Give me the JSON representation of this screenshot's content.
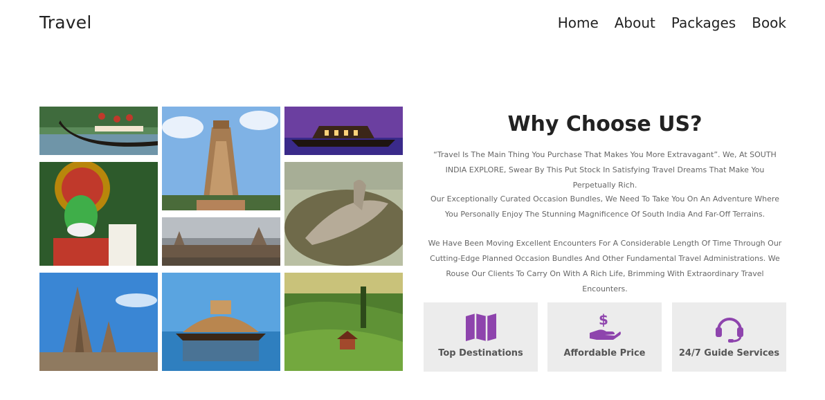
{
  "header": {
    "brand": "Travel",
    "nav": [
      "Home",
      "About",
      "Packages",
      "Book"
    ]
  },
  "about": {
    "title": "Why Choose US?",
    "paragraphs": [
      "“Travel Is The Main Thing You Purchase That Makes You More Extravagant”. We, At SOUTH INDIA EXPLORE, Swear By This Put Stock In Satisfying Travel Dreams That Make You Perpetually Rich.",
      "Our Exceptionally Curated Occasion Bundles, We Need To Take You On An Adventure Where You Personally Enjoy The Stunning Magnificence Of South India And Far-Off Terrains.",
      "We Have Been Moving Excellent Encounters For A Considerable Length Of Time Through Our Cutting-Edge Planned Occasion Bundles And Other Fundamental Travel Administrations. We Rouse Our Clients To Carry On With A Rich Life, Brimming With Extraordinary Travel Encounters."
    ]
  },
  "features": [
    {
      "label": "Top Destinations",
      "icon": "map-icon"
    },
    {
      "label": "Affordable Price",
      "icon": "hand-dollar-icon"
    },
    {
      "label": "24/7 Guide Services",
      "icon": "headset-icon"
    }
  ],
  "colors": {
    "accent": "#8e44ad",
    "feature_bg": "#ececec"
  }
}
